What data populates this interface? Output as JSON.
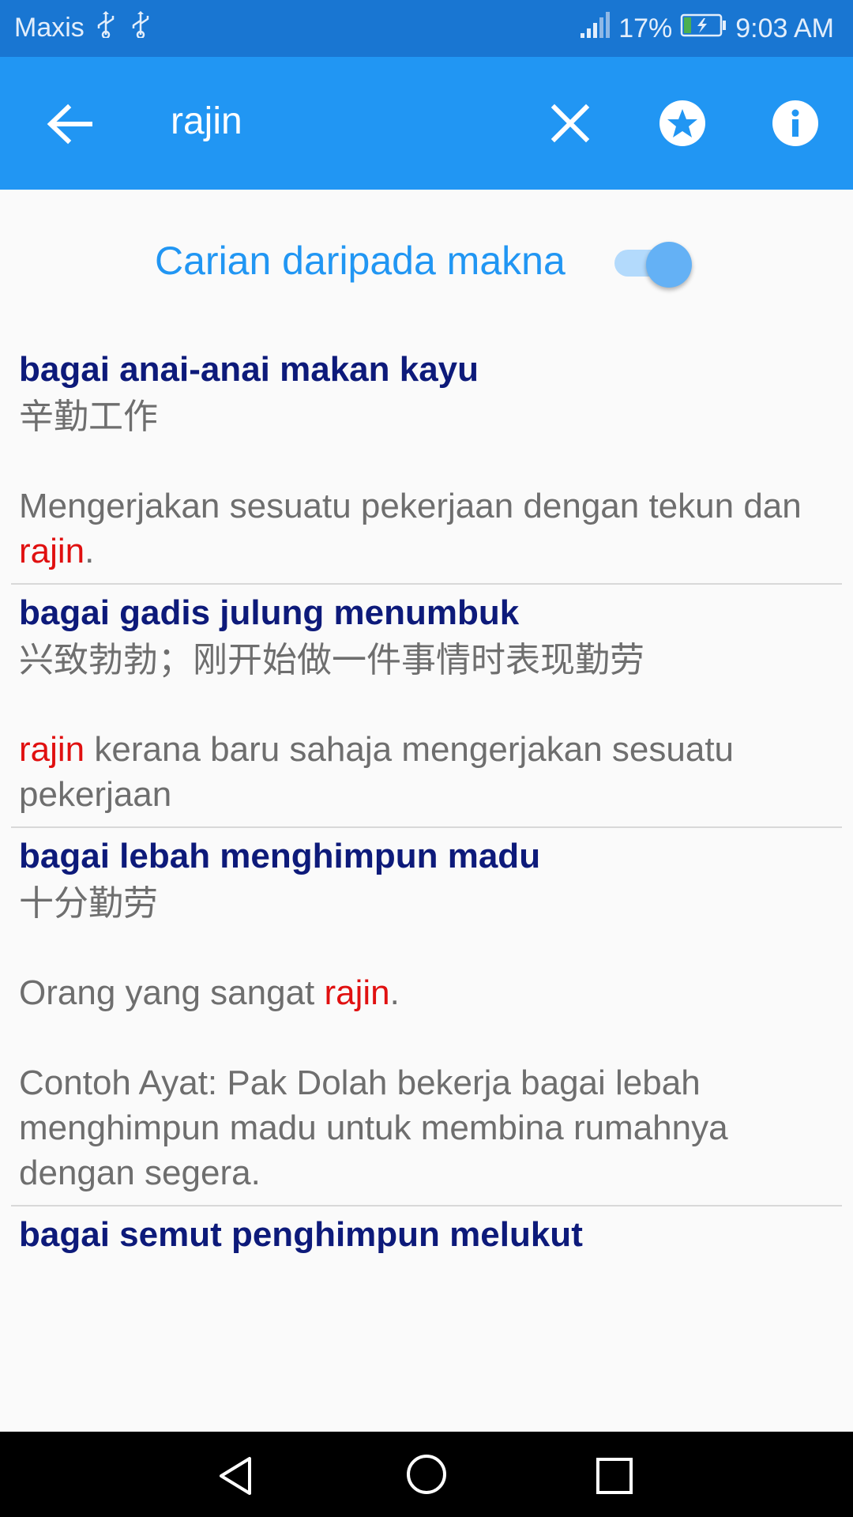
{
  "status_bar": {
    "carrier": "Maxis",
    "usb_icon": "usb-icon",
    "battery_percent": "17%",
    "time": "9:03 AM"
  },
  "app_bar": {
    "query": "rajin"
  },
  "toggle": {
    "label": "Carian daripada makna",
    "on": true
  },
  "entries": [
    {
      "title": "bagai anai-anai makan kayu",
      "zh": "辛勤工作",
      "defs": [
        [
          {
            "t": "Mengerjakan sesuatu pekerjaan dengan tekun dan "
          },
          {
            "t": "rajin",
            "hl": true
          },
          {
            "t": "."
          }
        ]
      ]
    },
    {
      "title": "bagai gadis julung menumbuk",
      "zh": "兴致勃勃；刚开始做一件事情时表现勤劳",
      "defs": [
        [
          {
            "t": "rajin",
            "hl": true
          },
          {
            "t": " kerana baru sahaja mengerjakan sesuatu pekerjaan"
          }
        ]
      ]
    },
    {
      "title": "bagai lebah menghimpun madu",
      "zh": "十分勤劳",
      "defs": [
        [
          {
            "t": "Orang yang sangat "
          },
          {
            "t": "rajin",
            "hl": true
          },
          {
            "t": "."
          }
        ],
        [
          {
            "t": "Contoh Ayat: Pak Dolah bekerja bagai lebah menghimpun madu untuk membina rumahnya dengan segera."
          }
        ]
      ]
    },
    {
      "title": "bagai semut penghimpun melukut",
      "zh": "",
      "defs": []
    }
  ],
  "colors": {
    "status_bar": "#1976d2",
    "app_bar": "#2196f3",
    "toggle_label": "#2196f3",
    "entry_title": "#0d1a7a",
    "highlight": "#e01010",
    "body_text": "#6e6e6e"
  }
}
